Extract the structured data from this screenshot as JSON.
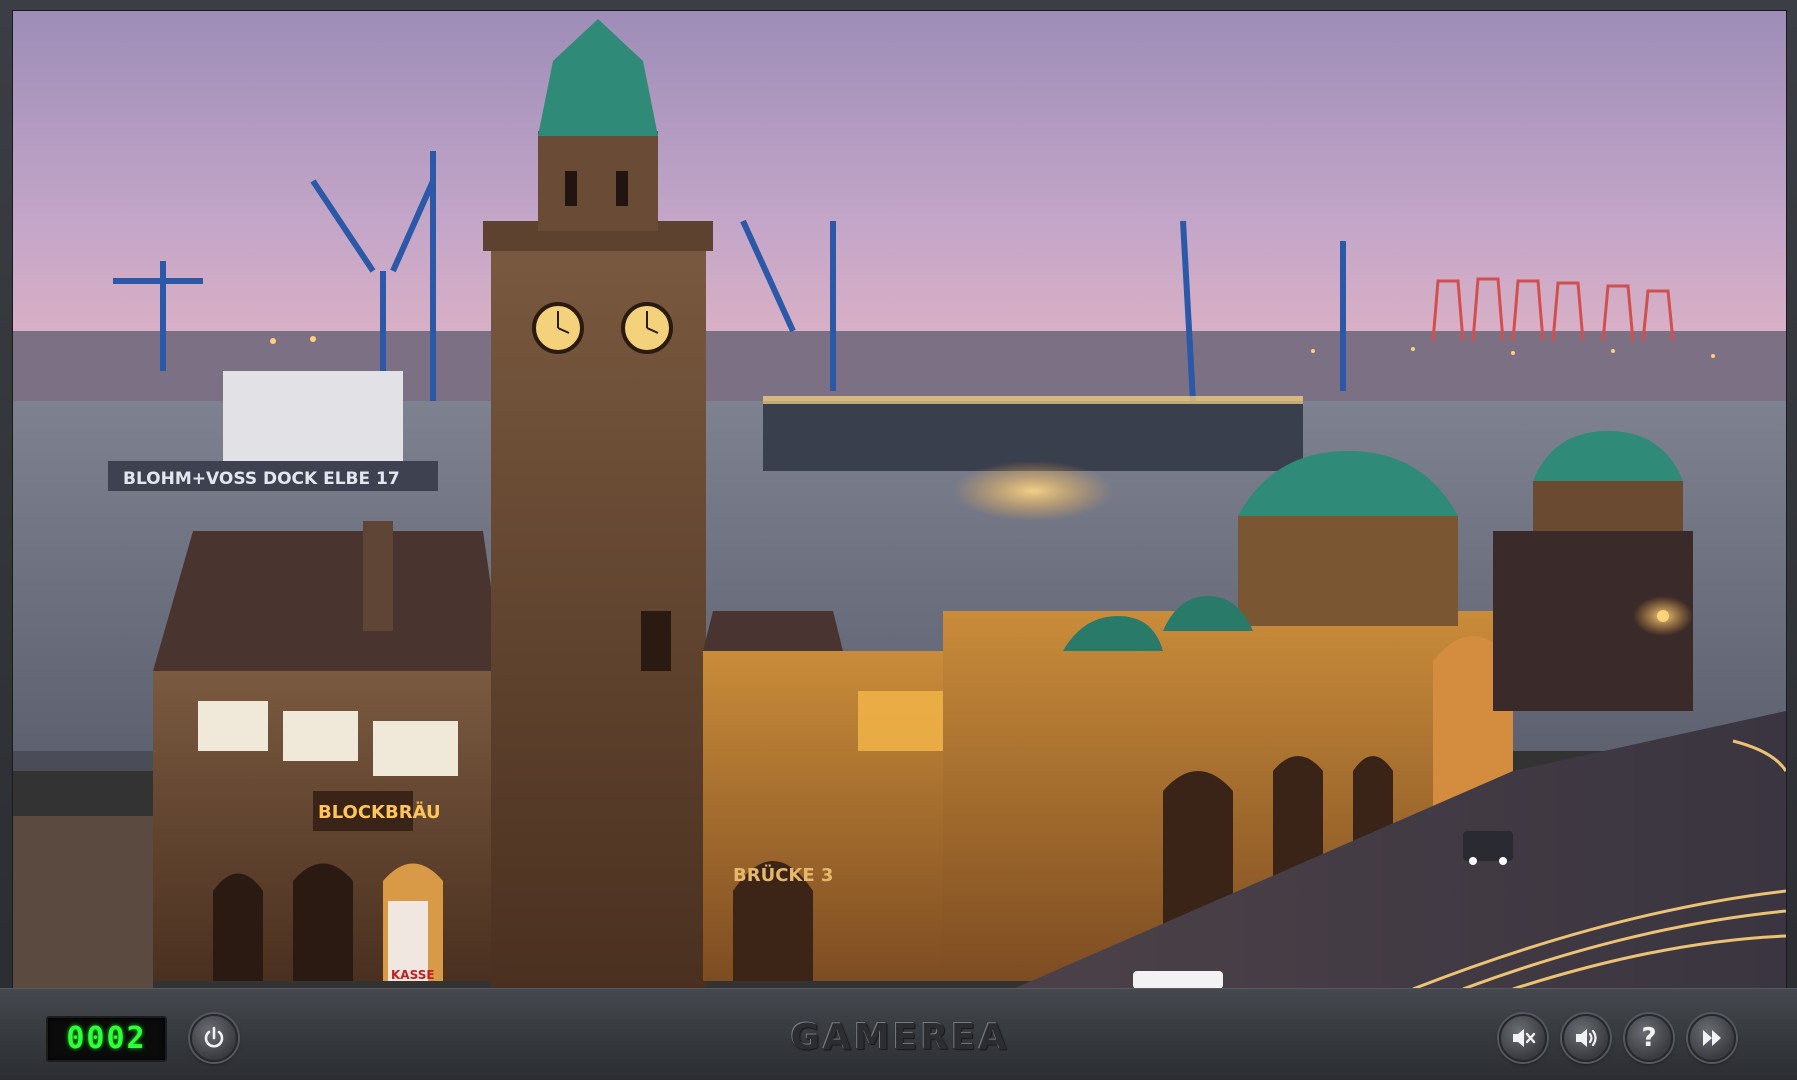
{
  "timer": {
    "value": "0002"
  },
  "branding": {
    "logo_text": "GAMEREA"
  },
  "controls": {
    "power_icon": "power-icon",
    "mute_icon": "speaker-mute-icon",
    "volume_icon": "speaker-volume-icon",
    "help_icon": "question-icon",
    "skip_icon": "fast-forward-icon",
    "help_glyph": "?"
  },
  "scene": {
    "dock_sign": "BLOHM+VOSS DOCK ELBE 17",
    "restaurant_sign": "BLOCKBRÄU",
    "bridge_sign": "BRÜCKE 3",
    "kasse_sign": "KASSE"
  },
  "colors": {
    "timer_digits": "#2dff38",
    "bar_background": "#34373c",
    "sky_top": "#9f8fba",
    "sky_bottom": "#e2b0c8",
    "water": "#6f7482",
    "stone": "#6b4a30",
    "copper_dome": "#2f8a78"
  }
}
